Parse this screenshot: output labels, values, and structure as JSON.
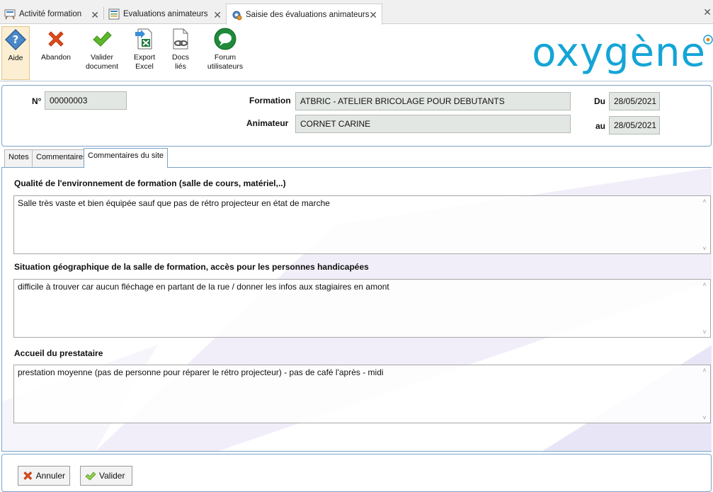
{
  "tabs": [
    {
      "label": "Activité formation",
      "icon": "training-activity-icon"
    },
    {
      "label": "Evaluations animateurs",
      "icon": "evaluation-list-icon"
    },
    {
      "label": "Saisie des évaluations animateurs",
      "icon": "gear-settings-icon",
      "active": true
    }
  ],
  "toolbar": {
    "help": "Aide",
    "cancel": "Abandon",
    "validate_line1": "Valider",
    "validate_line2": "document",
    "export_line1": "Export",
    "export_line2": "Excel",
    "docs_line1": "Docs",
    "docs_line2": "liés",
    "forum_line1": "Forum",
    "forum_line2": "utilisateurs"
  },
  "brand": {
    "logo_text": "oxygène",
    "accent_color": "#14a5d6"
  },
  "header": {
    "number_label": "N°",
    "number_value": "00000003",
    "formation_label": "Formation",
    "formation_value": "ATBRIC - ATELIER BRICOLAGE POUR DEBUTANTS",
    "animateur_label": "Animateur",
    "animateur_value": "CORNET CARINE",
    "from_label": "Du",
    "from_value": "28/05/2021",
    "to_label": "au",
    "to_value": "28/05/2021"
  },
  "subtabs": [
    {
      "label": "Notes"
    },
    {
      "label": "Commentaires"
    },
    {
      "label": "Commentaires du site",
      "active": true
    }
  ],
  "comments": [
    {
      "label": "Qualité de l'environnement de formation (salle de cours, matériel,..)",
      "value": "Salle très vaste et bien équipée sauf que pas de rétro projecteur en état de marche"
    },
    {
      "label": "Situation géographique de la salle de formation, accès pour les personnes handicapées",
      "value": "difficile à trouver car aucun fléchage en partant de la rue / donner les infos aux stagiaires en amont"
    },
    {
      "label": "Accueil du prestataire",
      "value": "prestation moyenne (pas de personne pour réparer le rétro projecteur) - pas de café l'après - midi"
    }
  ],
  "footer": {
    "cancel": "Annuler",
    "validate": "Valider"
  }
}
